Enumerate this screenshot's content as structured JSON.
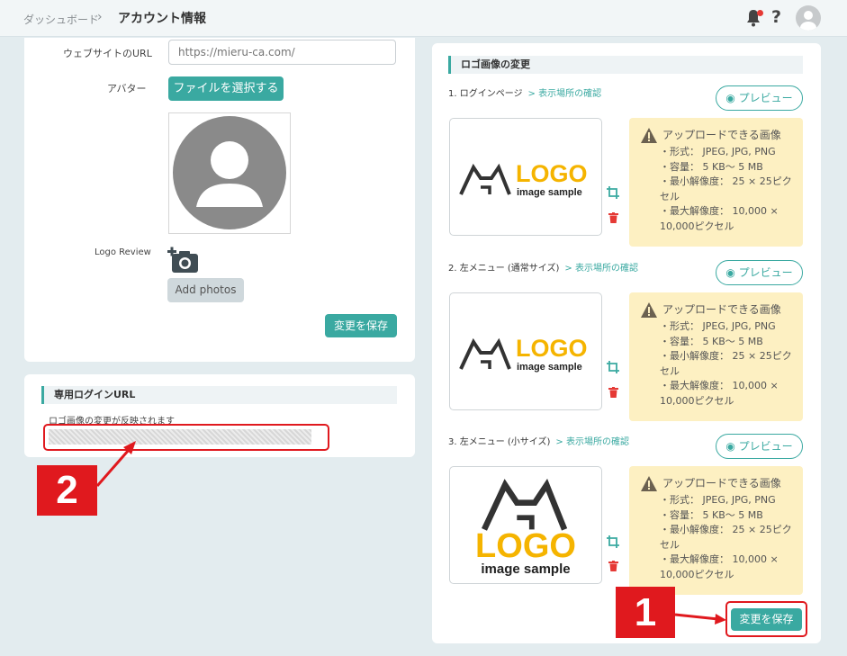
{
  "header": {
    "breadcrumb_root": "ダッシュボード",
    "breadcrumb_sep": "›",
    "breadcrumb_current": "アカウント情報",
    "help_label": "?"
  },
  "profile": {
    "website_label": "ウェブサイトのURL",
    "website_placeholder": "https://mieru-ca.com/",
    "avatar_label": "アバター",
    "choose_file_label": "ファイルを選択する",
    "logo_review_label": "Logo Review",
    "add_photos_label": "Add photos",
    "save_label": "変更を保存"
  },
  "login": {
    "title": "専用ログインURL",
    "note": "ロゴ画像の変更が反映されます"
  },
  "logo_section": {
    "title": "ロゴ画像の変更",
    "items": [
      {
        "title": "1. ログインページ",
        "link": "> 表示場所の確認",
        "preview": "プレビュー"
      },
      {
        "title": "2. 左メニュー (通常サイズ)",
        "link": "> 表示場所の確認",
        "preview": "プレビュー"
      },
      {
        "title": "3. 左メニュー (小サイズ)",
        "link": "> 表示場所の確認",
        "preview": "プレビュー"
      }
    ],
    "info": {
      "title": "アップロードできる画像",
      "lines": [
        "・形式： JPEG, JPG, PNG",
        "・容量： 5 KB～ 5 MB",
        "・最小解像度： 25 × 25ピクセル",
        "・最大解像度： 10,000 × 10,000ピクセル"
      ]
    },
    "logo_word": "LOGO",
    "logo_sub": "image sample",
    "save_label": "変更を保存"
  },
  "annotations": {
    "badge1": "1",
    "badge2": "2"
  },
  "colors": {
    "accent": "#3aa9a1",
    "warning_bg": "#fdf0c2",
    "annotation_red": "#e0191e",
    "logo_yellow": "#f5b400"
  }
}
